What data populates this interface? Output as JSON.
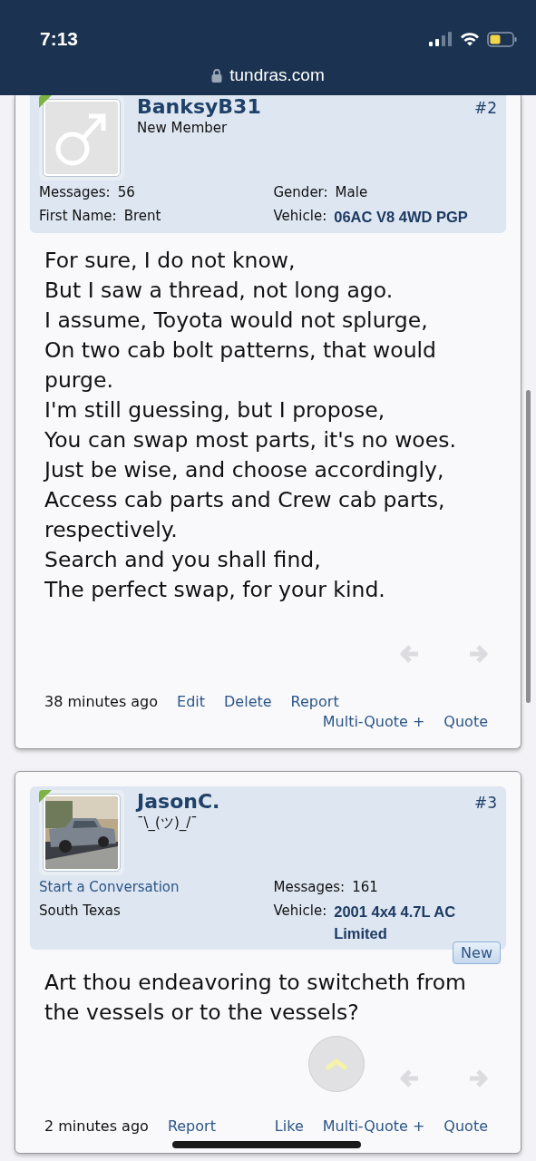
{
  "status_bar": {
    "time": "7:13",
    "url": "tundras.com"
  },
  "posts": [
    {
      "author": "BanksyB31",
      "title": "New Member",
      "number": "#2",
      "online": true,
      "avatar": {
        "kind": "placeholder"
      },
      "info_left": [
        {
          "kind": "field",
          "label": "Messages:",
          "value": "56"
        },
        {
          "kind": "field",
          "label": "First Name:",
          "value": "Brent"
        }
      ],
      "info_right": [
        {
          "kind": "field",
          "label": "Gender:",
          "value": "Male"
        },
        {
          "kind": "vehicle",
          "label": "Vehicle:",
          "value": "06AC V8 4WD PGP"
        }
      ],
      "body": [
        "For sure, I do not know,",
        "But I saw a thread, not long ago.",
        "I assume, Toyota would not splurge,",
        "On two cab bolt patterns, that would purge.",
        "I'm still guessing, but I propose,",
        "You can swap most parts, it's no woes.",
        "Just be wise, and choose accordingly,",
        "Access cab parts and Crew cab parts, respectively.",
        "Search and you shall find,",
        "The perfect swap, for your kind."
      ],
      "time": "38 minutes ago",
      "actions_left": [
        "Edit",
        "Delete",
        "Report"
      ],
      "actions_right": [
        "Multi-Quote +",
        "Quote"
      ]
    },
    {
      "author": "JasonC.",
      "title": "¯\\_(ツ)_/¯",
      "number": "#3",
      "online": true,
      "avatar": {
        "kind": "picture"
      },
      "info_left": [
        {
          "kind": "link",
          "value": "Start a Conversation"
        },
        {
          "kind": "text",
          "value": "South Texas"
        }
      ],
      "info_right": [
        {
          "kind": "field",
          "label": "Messages:",
          "value": "161"
        },
        {
          "kind": "vehicle",
          "label": "Vehicle:",
          "value": "2001 4x4 4.7L AC Limited"
        }
      ],
      "body": [
        "Art thou endeavoring to switcheth from the vessels or to the vessels?"
      ],
      "new_badge": "New",
      "time": "2 minutes ago",
      "actions_left": [
        "Report"
      ],
      "actions_right": [
        "Like",
        "Multi-Quote +",
        "Quote"
      ]
    }
  ]
}
